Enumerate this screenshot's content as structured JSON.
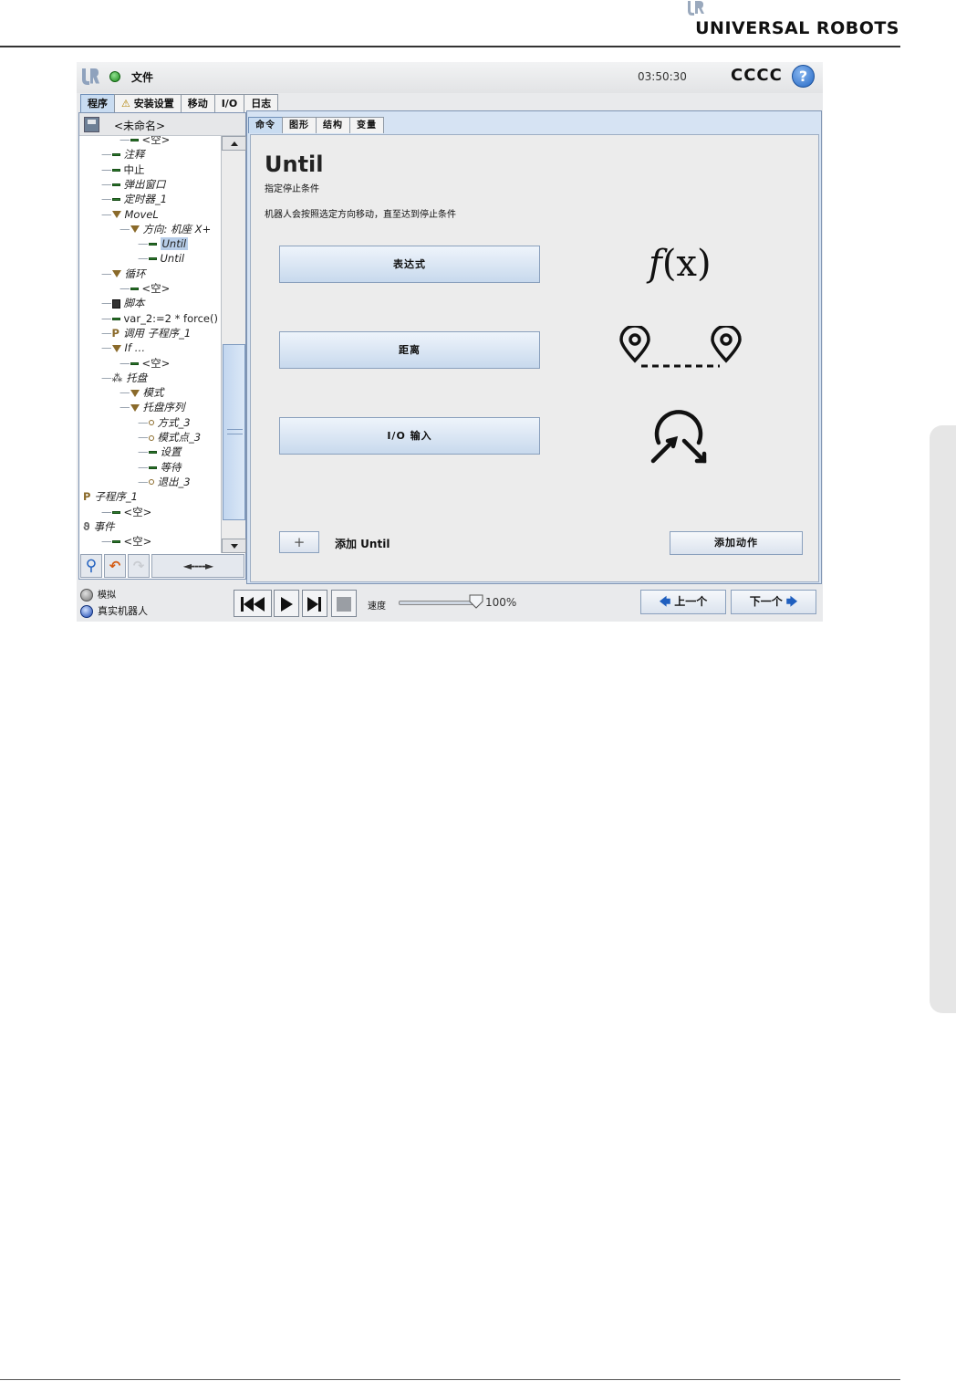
{
  "page": {
    "brand": "UNIVERSAL ROBOTS"
  },
  "app": {
    "file_menu": "文件",
    "clock": "03:50:30",
    "robot_name": "CCCC",
    "help": "?",
    "main_tabs": [
      "程序",
      "安装设置",
      "移动",
      "I/O",
      "日志"
    ],
    "program_name": "<未命名>"
  },
  "tree": [
    {
      "label": "<空>",
      "icon": "bar-icon",
      "indent": 2
    },
    {
      "label": "注释",
      "icon": "bar-icon",
      "indent": 1
    },
    {
      "label": "中止",
      "icon": "bar-icon",
      "indent": 1
    },
    {
      "label": "弹出窗口",
      "icon": "bar-icon",
      "indent": 1
    },
    {
      "label": "定时器_1",
      "icon": "bar-icon",
      "indent": 1
    },
    {
      "label": "MoveL",
      "icon": "triangle-icon",
      "indent": 1
    },
    {
      "label": "方向: 机座 X+",
      "icon": "triangle-icon",
      "indent": 2
    },
    {
      "label": "Until",
      "icon": "bar-icon",
      "indent": 3,
      "selected": true
    },
    {
      "label": "Until",
      "icon": "bar-icon",
      "indent": 3
    },
    {
      "label": "循环",
      "icon": "triangle-icon",
      "indent": 1
    },
    {
      "label": "<空>",
      "icon": "bar-icon",
      "indent": 2
    },
    {
      "label": "脚本",
      "icon": "script-icon",
      "indent": 1
    },
    {
      "label": "var_2:=2 * force()",
      "icon": "bar-icon",
      "indent": 1
    },
    {
      "label": "调用 子程序_1",
      "icon": "flag-icon",
      "indent": 1
    },
    {
      "label": "If …",
      "icon": "triangle-icon",
      "indent": 1
    },
    {
      "label": "<空>",
      "icon": "bar-icon",
      "indent": 2
    },
    {
      "label": "托盘",
      "icon": "pallet-icon",
      "indent": 1
    },
    {
      "label": "模式",
      "icon": "triangle-icon",
      "indent": 2
    },
    {
      "label": "托盘序列",
      "icon": "triangle-icon",
      "indent": 2
    },
    {
      "label": "方式_3",
      "icon": "waypoint-icon",
      "indent": 3
    },
    {
      "label": "模式点_3",
      "icon": "waypoint-icon",
      "indent": 3
    },
    {
      "label": "设置",
      "icon": "bar-icon",
      "indent": 3
    },
    {
      "label": "等待",
      "icon": "bar-icon",
      "indent": 3
    },
    {
      "label": "退出_3",
      "icon": "waypoint-icon",
      "indent": 3
    },
    {
      "label": "子程序_1",
      "icon": "flag-icon",
      "indent": 0
    },
    {
      "label": "<空>",
      "icon": "bar-icon",
      "indent": 1
    },
    {
      "label": "事件",
      "icon": "event-icon",
      "indent": 0
    },
    {
      "label": "<空>",
      "icon": "bar-icon",
      "indent": 1
    }
  ],
  "tree_tools": {
    "move": "◄----►"
  },
  "sub_tabs": [
    "命令",
    "图形",
    "结构",
    "变量"
  ],
  "command": {
    "title": "Until",
    "subtitle": "指定停止条件",
    "description": "机器人会按照选定方向移动，直至达到停止条件",
    "options": [
      "表达式",
      "距离",
      "I/O 输入"
    ],
    "add_icon": "+",
    "add_label": "添加 Until",
    "add_action": "添加动作"
  },
  "bottom": {
    "mode_sim": "模拟",
    "mode_real": "真实机器人",
    "speed_label": "速度",
    "speed_value": "100%",
    "speed_fraction": 1.0,
    "prev": "上一个",
    "next": "下一个"
  }
}
